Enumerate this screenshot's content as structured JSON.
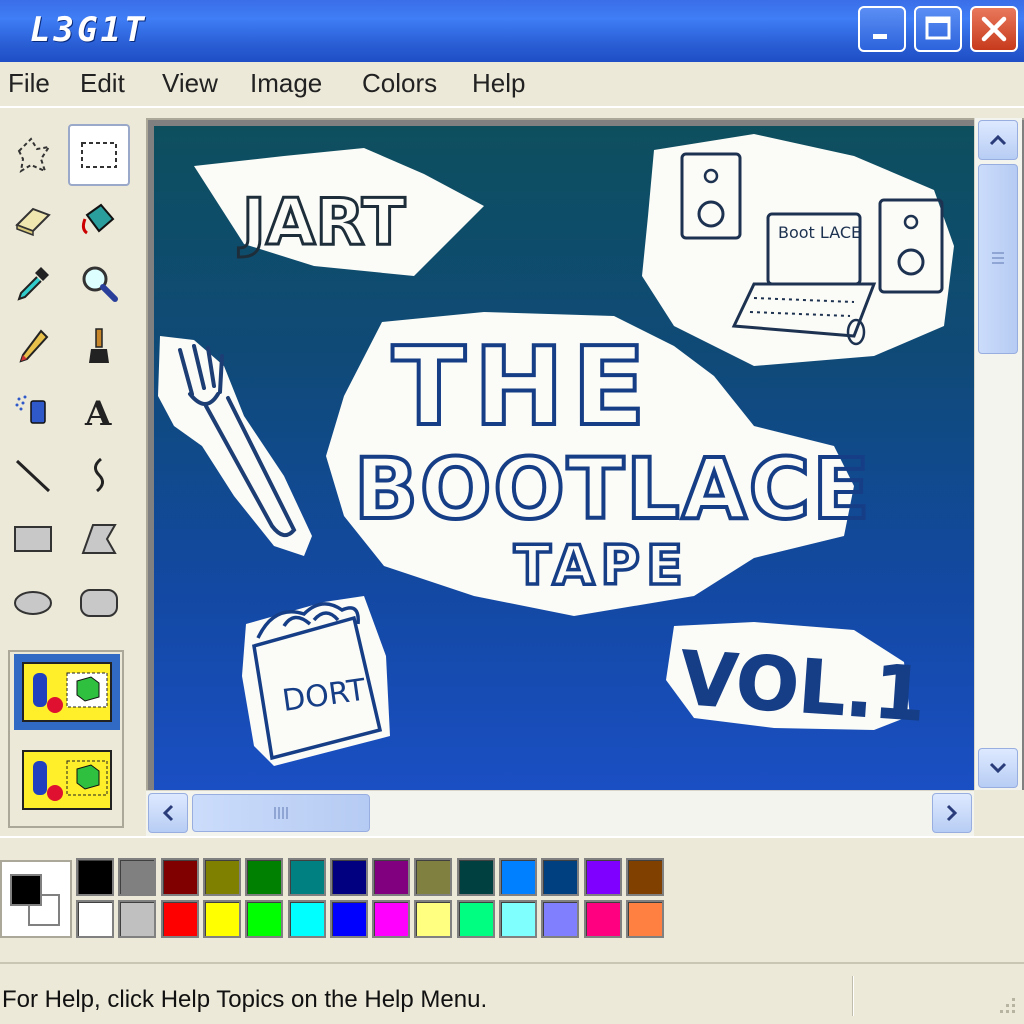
{
  "window": {
    "title": "L3G1T",
    "controls": {
      "minimize": "minimize",
      "maximize": "maximize",
      "close": "close"
    }
  },
  "menu": {
    "items": [
      "File",
      "Edit",
      "View",
      "Image",
      "Colors",
      "Help"
    ]
  },
  "tools": [
    "free-form-select",
    "select",
    "eraser",
    "fill-with-color",
    "pick-color",
    "magnifier",
    "pencil",
    "brush",
    "airbrush",
    "text",
    "line",
    "curve",
    "rectangle",
    "polygon",
    "ellipse",
    "rounded-rectangle"
  ],
  "active_tool": "select",
  "canvas": {
    "artwork_texts": {
      "jart": "JART",
      "title_line1": "THE",
      "title_line2": "BOOTLACE",
      "title_line3": "TAPE",
      "vol": "VOL.1",
      "bag": "DORT",
      "laptop_screen": "Boot LACE"
    },
    "colors": {
      "bg_top": "#0e4f5e",
      "bg_bottom": "#1a4fc4",
      "ink": "#163e86",
      "paper": "#fbfbf7"
    }
  },
  "palette": {
    "foreground": "#000000",
    "background": "#ffffff",
    "row1": [
      "#000000",
      "#808080",
      "#800000",
      "#808000",
      "#008000",
      "#008080",
      "#000080",
      "#800080",
      "#808040",
      "#004040",
      "#0080ff",
      "#004080",
      "#8000ff",
      "#804000"
    ],
    "row2": [
      "#ffffff",
      "#c0c0c0",
      "#ff0000",
      "#ffff00",
      "#00ff00",
      "#00ffff",
      "#0000ff",
      "#ff00ff",
      "#ffff80",
      "#00ff80",
      "#80ffff",
      "#8080ff",
      "#ff0080",
      "#ff8040"
    ]
  },
  "status": {
    "help_text": "For Help, click Help Topics on the Help Menu."
  }
}
